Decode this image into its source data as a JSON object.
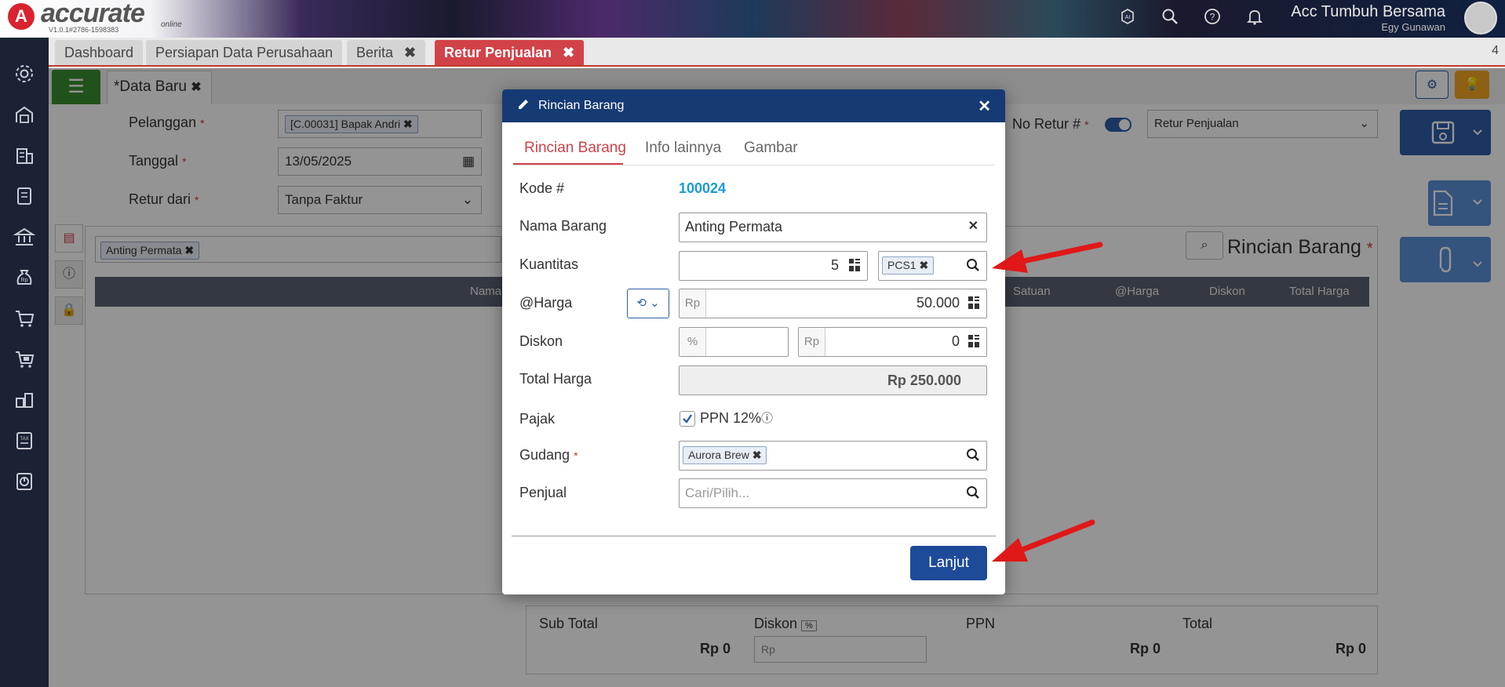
{
  "app": {
    "logo_letter": "A",
    "logo_name": "accurate",
    "logo_sub": "online",
    "version": "V1.0.1#2786-1598383",
    "company": "Acc Tumbuh Bersama",
    "user": "Egy Gunawan"
  },
  "tabs": [
    {
      "label": "Dashboard",
      "closable": false
    },
    {
      "label": "Persiapan Data Perusahaan",
      "closable": false
    },
    {
      "label": "Berita",
      "closable": true
    },
    {
      "label": "Retur Penjualan",
      "closable": true,
      "active": true
    }
  ],
  "tab_close_glyph": "✖",
  "tab_count": "4",
  "form": {
    "data_baru_tab": "*Data Baru",
    "pelanggan_label": "Pelanggan",
    "pelanggan_value": "[C.00031] Bapak Andri",
    "tanggal_label": "Tanggal",
    "tanggal_value": "13/05/2025",
    "retur_dari_label": "Retur dari",
    "retur_dari_value": "Tanpa Faktur",
    "no_retur_label": "No Retur #",
    "retur_type_value": "Retur Penjualan",
    "required_mark": "*"
  },
  "grid": {
    "search_chip": "Anting Permata",
    "title": "Rincian Barang",
    "columns": [
      "Nama Ba",
      "tas",
      "Satuan",
      "@Harga",
      "Diskon",
      "Total Harga"
    ]
  },
  "totals": {
    "sub_total_label": "Sub Total",
    "sub_total_value": "Rp 0",
    "diskon_label": "Diskon",
    "diskon_badge": "%",
    "diskon_prefix": "Rp",
    "ppn_label": "PPN",
    "ppn_value": "Rp 0",
    "total_label": "Total",
    "total_value": "Rp 0"
  },
  "modal": {
    "title": "Rincian Barang",
    "close": "✕",
    "tabs": [
      "Rincian Barang",
      "Info lainnya",
      "Gambar"
    ],
    "kode_label": "Kode #",
    "kode_value": "100024",
    "nama_label": "Nama Barang",
    "nama_value": "Anting Permata",
    "kuantitas_label": "Kuantitas",
    "kuantitas_value": "5",
    "unit_chip": "PCS1",
    "harga_label": "@Harga",
    "harga_prefix": "Rp",
    "harga_value": "50.000",
    "diskon_label": "Diskon",
    "diskon_pct_prefix": "%",
    "diskon_rp_prefix": "Rp",
    "diskon_value": "0",
    "total_label": "Total Harga",
    "total_value": "Rp 250.000",
    "pajak_label": "Pajak",
    "ppn_checkbox_label": "PPN 12%",
    "ppn_checked": true,
    "gudang_label": "Gudang",
    "gudang_value": "Aurora Brew",
    "penjual_label": "Penjual",
    "penjual_placeholder": "Cari/Pilih...",
    "submit_label": "Lanjut"
  },
  "colors": {
    "accent_red": "#d24249",
    "modal_header": "#163a73",
    "link_blue": "#1a9bd7",
    "submit_blue": "#1e4a9a",
    "annotation_arrow": "#e01818"
  }
}
